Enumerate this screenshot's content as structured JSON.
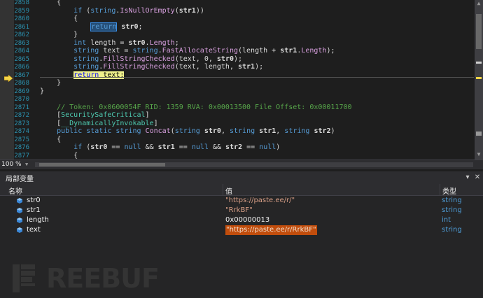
{
  "editor": {
    "lines": [
      {
        "num": "2858",
        "html": "<span>    {</span>"
      },
      {
        "num": "2859",
        "html": "        <span class=\"kw\">if</span> (<span class=\"kw\">string</span>.<span class=\"fn\">IsNullOrEmpty</span>(<span class=\"id\">str1</span>))"
      },
      {
        "num": "2860",
        "html": "        {"
      },
      {
        "num": "2861",
        "html": "            <span class=\"retbox\">return</span> <span class=\"id\">str0</span>;"
      },
      {
        "num": "2862",
        "html": "        }"
      },
      {
        "num": "2863",
        "html": "        <span class=\"kw\">int</span> length = <span class=\"id\">str0</span>.<span class=\"fn\">Length</span>;"
      },
      {
        "num": "2864",
        "html": "        <span class=\"kw\">string</span> text = <span class=\"kw\">string</span>.<span class=\"fn\">FastAllocateString</span>(length + <span class=\"id\">str1</span>.<span class=\"fn\">Length</span>);"
      },
      {
        "num": "2865",
        "html": "        <span class=\"kw\">string</span>.<span class=\"fn\">FillStringChecked</span>(text, 0, <span class=\"id\">str0</span>);"
      },
      {
        "num": "2866",
        "html": "        <span class=\"kw\">string</span>.<span class=\"fn\">FillStringChecked</span>(text, length, <span class=\"id\">str1</span>);"
      },
      {
        "num": "2867",
        "html": "        <span class=\"yellow-bg\"><span class=\"kw\" style=\"color:#0000ff\">return</span> text;</span>"
      },
      {
        "num": "2868",
        "html": "    }"
      },
      {
        "num": "2869",
        "html": "}"
      },
      {
        "num": "2870",
        "html": ""
      },
      {
        "num": "2871",
        "html": "    <span class=\"cm\">// Token: 0x0600054F RID: 1359 RVA: 0x00013500 File Offset: 0x00011700</span>"
      },
      {
        "num": "2872",
        "html": "    [<span class=\"tp\">SecuritySafeCritical</span>]"
      },
      {
        "num": "2873",
        "html": "    [<span class=\"tp\">__DynamicallyInvokable</span>]"
      },
      {
        "num": "2874",
        "html": "    <span class=\"kw\">public static string</span> <span class=\"fn\">Concat</span>(<span class=\"kw\">string</span> <span class=\"id\">str0</span>, <span class=\"kw\">string</span> <span class=\"id\">str1</span>, <span class=\"kw\">string</span> <span class=\"id\">str2</span>)"
      },
      {
        "num": "2875",
        "html": "    {"
      },
      {
        "num": "2876",
        "html": "        <span class=\"kw\">if</span> (<span class=\"id\">str0</span> == <span class=\"kw\">null</span> &amp;&amp; <span class=\"id\">str1</span> == <span class=\"kw\">null</span> &amp;&amp; <span class=\"id\">str2</span> == <span class=\"kw\">null</span>)"
      },
      {
        "num": "2877",
        "html": "        {"
      }
    ]
  },
  "status": {
    "zoom": "100 %"
  },
  "locals": {
    "title": "局部变量",
    "columns": {
      "name": "名称",
      "value": "值",
      "type": "类型"
    },
    "rows": [
      {
        "name": "str0",
        "value": "\"https://paste.ee/r/\"",
        "type": "string"
      },
      {
        "name": "str1",
        "value": "\"RrkBF\"",
        "type": "string"
      },
      {
        "name": "length",
        "value": "0x00000013",
        "type": "int"
      },
      {
        "name": "text",
        "value": "\"https://paste.ee/r/RrkBF\"",
        "type": "string"
      }
    ]
  },
  "watermark": {
    "text": "REEBUF"
  },
  "colors": {
    "accent": "#007acc",
    "breakpoint_arrow": "#f5d547",
    "string_value": "#d69d85",
    "type": "#4e9cd6"
  },
  "icons": {
    "variable": "variable-cube-icon",
    "pin": "pin-icon",
    "close": "close-icon",
    "current_line": "current-statement-arrow-icon"
  }
}
